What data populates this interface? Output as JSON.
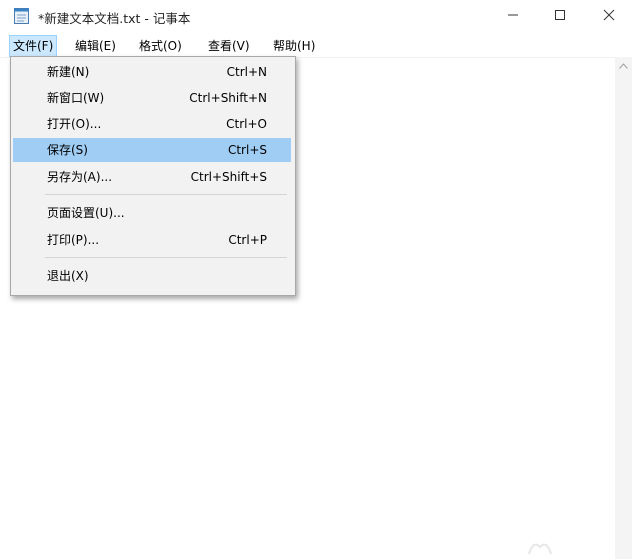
{
  "window": {
    "title": "*新建文本文档.txt - 记事本",
    "controls": {
      "minimize": "—",
      "maximize": "☐",
      "close": "✕"
    }
  },
  "menubar": {
    "items": [
      {
        "label": "文件(F)",
        "active": true
      },
      {
        "label": "编辑(E)"
      },
      {
        "label": "格式(O)"
      },
      {
        "label": "查看(V)"
      },
      {
        "label": "帮助(H)"
      }
    ]
  },
  "file_menu": {
    "items": [
      {
        "label": "新建(N)",
        "shortcut": "Ctrl+N"
      },
      {
        "label": "新窗口(W)",
        "shortcut": "Ctrl+Shift+N"
      },
      {
        "label": "打开(O)...",
        "shortcut": "Ctrl+O"
      },
      {
        "label": "保存(S)",
        "shortcut": "Ctrl+S",
        "highlighted": true
      },
      {
        "label": "另存为(A)...",
        "shortcut": "Ctrl+Shift+S"
      },
      {
        "label": "页面设置(U)...",
        "shortcut": ""
      },
      {
        "label": "打印(P)...",
        "shortcut": "Ctrl+P"
      },
      {
        "label": "退出(X)",
        "shortcut": ""
      }
    ]
  },
  "editor": {
    "content": ""
  },
  "colors": {
    "highlight": "#9fcdf4",
    "menu_active": "#cce8ff",
    "menu_bg": "#f2f2f2"
  },
  "icons": {
    "app": "notepad-icon",
    "scroll_up": "chevron-up-icon"
  }
}
